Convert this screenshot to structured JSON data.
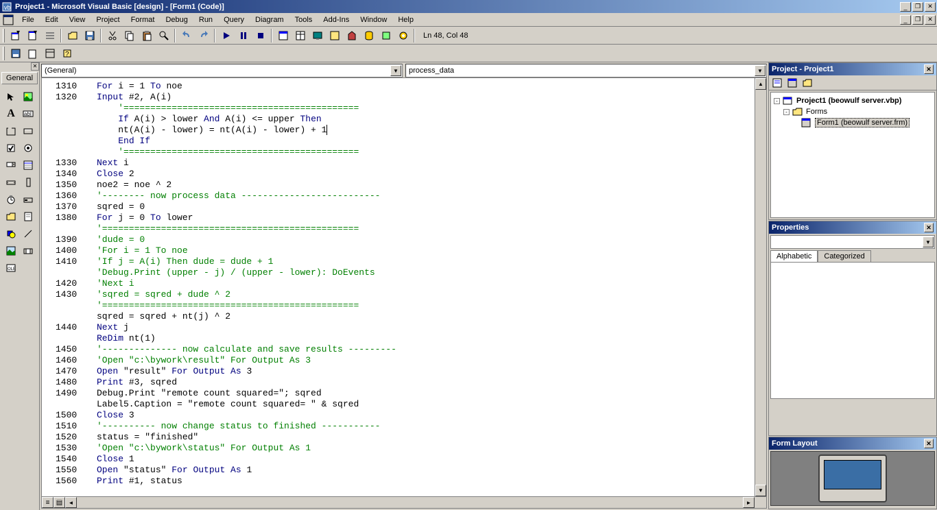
{
  "titlebar": {
    "text": "Project1 - Microsoft Visual Basic [design] - [Form1 (Code)]"
  },
  "menu": [
    "File",
    "Edit",
    "View",
    "Project",
    "Format",
    "Debug",
    "Run",
    "Query",
    "Diagram",
    "Tools",
    "Add-Ins",
    "Window",
    "Help"
  ],
  "status": "Ln 48, Col 48",
  "leftDock": {
    "tab": "General"
  },
  "combos": {
    "object": "(General)",
    "proc": "process_data"
  },
  "code": [
    {
      "num": "1310",
      "kw1": "For ",
      "t1": "i = 1 ",
      "kw2": "To ",
      "t2": "noe"
    },
    {
      "num": "1320",
      "kw1": "Input ",
      "t1": "#2, A(i)"
    },
    {
      "num": "",
      "cm": "    '============================================"
    },
    {
      "num": "",
      "t0": "    ",
      "kw1": "If ",
      "t1": "A(i) > lower ",
      "kw2": "And ",
      "t2": "A(i) <= upper ",
      "kw3": "Then"
    },
    {
      "num": "",
      "t1": "    nt(A(i) - lower) = nt(A(i) - lower) + 1",
      "cursor": true
    },
    {
      "num": "",
      "t0": "    ",
      "kw1": "End If"
    },
    {
      "num": "",
      "cm": "    '============================================"
    },
    {
      "num": "1330",
      "kw1": "Next ",
      "t1": "i"
    },
    {
      "num": "1340",
      "kw1": "Close ",
      "t1": "2"
    },
    {
      "num": "1350",
      "t1": "noe2 = noe ^ 2"
    },
    {
      "num": "1360",
      "cm": "'-------- now process data --------------------------"
    },
    {
      "num": "1370",
      "t1": "sqred = 0"
    },
    {
      "num": "1380",
      "kw1": "For ",
      "t1": "j = 0 ",
      "kw2": "To ",
      "t2": "lower"
    },
    {
      "num": "",
      "cm": "'================================================"
    },
    {
      "num": "1390",
      "cm": "'dude = 0"
    },
    {
      "num": "1400",
      "cm": "'For i = 1 To noe"
    },
    {
      "num": "1410",
      "cm": "'If j = A(i) Then dude = dude + 1"
    },
    {
      "num": "",
      "cm": "'Debug.Print (upper - j) / (upper - lower): DoEvents"
    },
    {
      "num": "1420",
      "cm": "'Next i"
    },
    {
      "num": "1430",
      "cm": "'sqred = sqred + dude ^ 2"
    },
    {
      "num": "",
      "cm": "'================================================"
    },
    {
      "num": "",
      "t1": "sqred = sqred + nt(j) ^ 2"
    },
    {
      "num": "1440",
      "kw1": "Next ",
      "t1": "j"
    },
    {
      "num": "",
      "kw1": "ReDim ",
      "t1": "nt(1)"
    },
    {
      "num": "1450",
      "cm": "'-------------- now calculate and save results ---------"
    },
    {
      "num": "1460",
      "cm": "'Open \"c:\\bywork\\result\" For Output As 3"
    },
    {
      "num": "1470",
      "kw1": "Open ",
      "t1": "\"result\" ",
      "kw2": "For Output As ",
      "t2": "3"
    },
    {
      "num": "1480",
      "kw1": "Print ",
      "t1": "#3, sqred"
    },
    {
      "num": "1490",
      "t1": "Debug.Print \"remote count squared=\"; sqred"
    },
    {
      "num": "",
      "t1": "Label5.Caption = \"remote count squared= \" & sqred"
    },
    {
      "num": "1500",
      "kw1": "Close ",
      "t1": "3"
    },
    {
      "num": "1510",
      "cm": "'---------- now change status to finished -----------"
    },
    {
      "num": "1520",
      "t1": "status = \"finished\""
    },
    {
      "num": "1530",
      "cm": "'Open \"c:\\bywork\\status\" For Output As 1"
    },
    {
      "num": "1540",
      "kw1": "Close ",
      "t1": "1"
    },
    {
      "num": "1550",
      "kw1": "Open ",
      "t1": "\"status\" ",
      "kw2": "For Output As ",
      "t2": "1"
    },
    {
      "num": "1560",
      "kw1": "Print ",
      "t1": "#1, status"
    }
  ],
  "project": {
    "title": "Project - Project1",
    "root": "Project1 (beowulf server.vbp)",
    "folder": "Forms",
    "form": "Form1 (beowulf server.frm)"
  },
  "props": {
    "title": "Properties",
    "tabs": [
      "Alphabetic",
      "Categorized"
    ]
  },
  "layout": {
    "title": "Form Layout"
  }
}
